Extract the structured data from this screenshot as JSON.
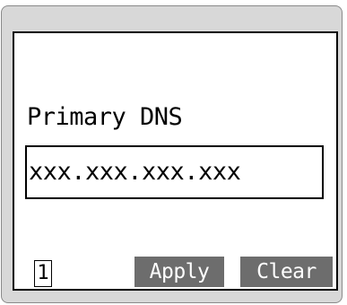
{
  "field": {
    "label": "Primary DNS",
    "value": "xxx.xxx.xxx.xxx"
  },
  "footer": {
    "page_number": "1",
    "apply_label": "Apply",
    "clear_label": "Clear"
  },
  "colors": {
    "frame": "#d8d8d8",
    "screen": "#ffffff",
    "button": "#6d6d6d",
    "button_text": "#ffffff"
  }
}
